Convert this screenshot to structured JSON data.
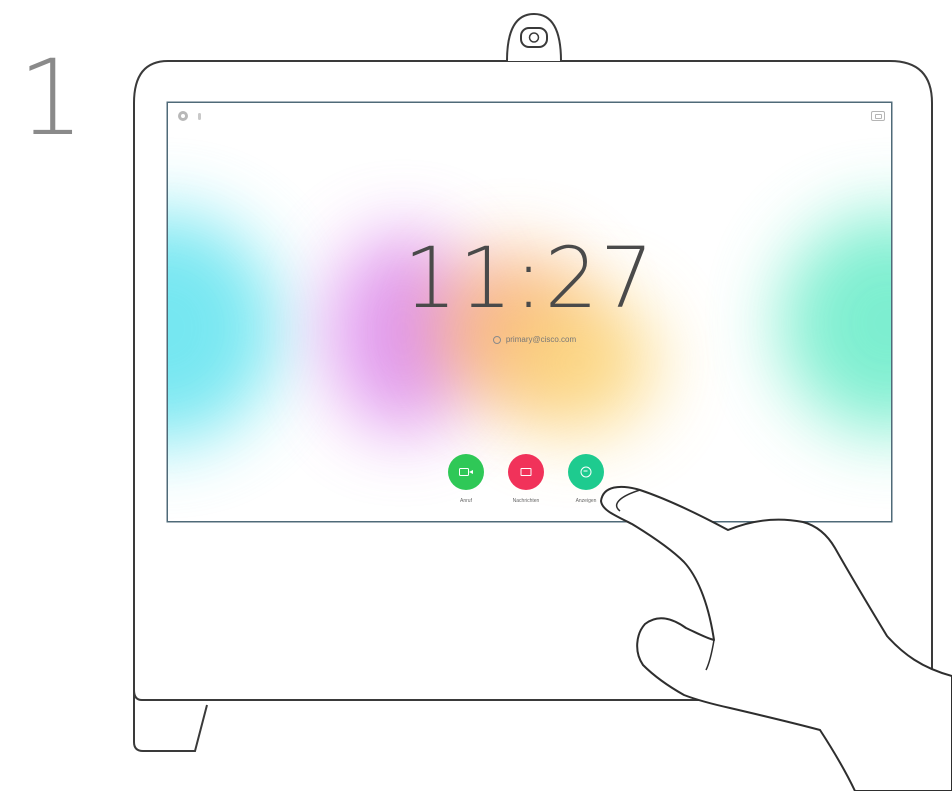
{
  "step": {
    "number": "1"
  },
  "home_screen": {
    "time": "11:27",
    "sip_address": "primary@cisco.com",
    "status_icons": [
      "settings-icon",
      "microphone-icon"
    ],
    "top_right_icon": "selfview-icon",
    "actions": [
      {
        "label": "Anruf",
        "icon": "video-call-icon",
        "color": "#2fc857"
      },
      {
        "label": "Nachrichten",
        "icon": "messages-icon",
        "color": "#f1325a"
      },
      {
        "label": "Anzeigen",
        "icon": "share-icon",
        "color": "#1ecb8f"
      }
    ]
  },
  "colors": {
    "outline": "#3a3a3a",
    "screen_border": "#4f6a78",
    "background": "#ffffff"
  }
}
